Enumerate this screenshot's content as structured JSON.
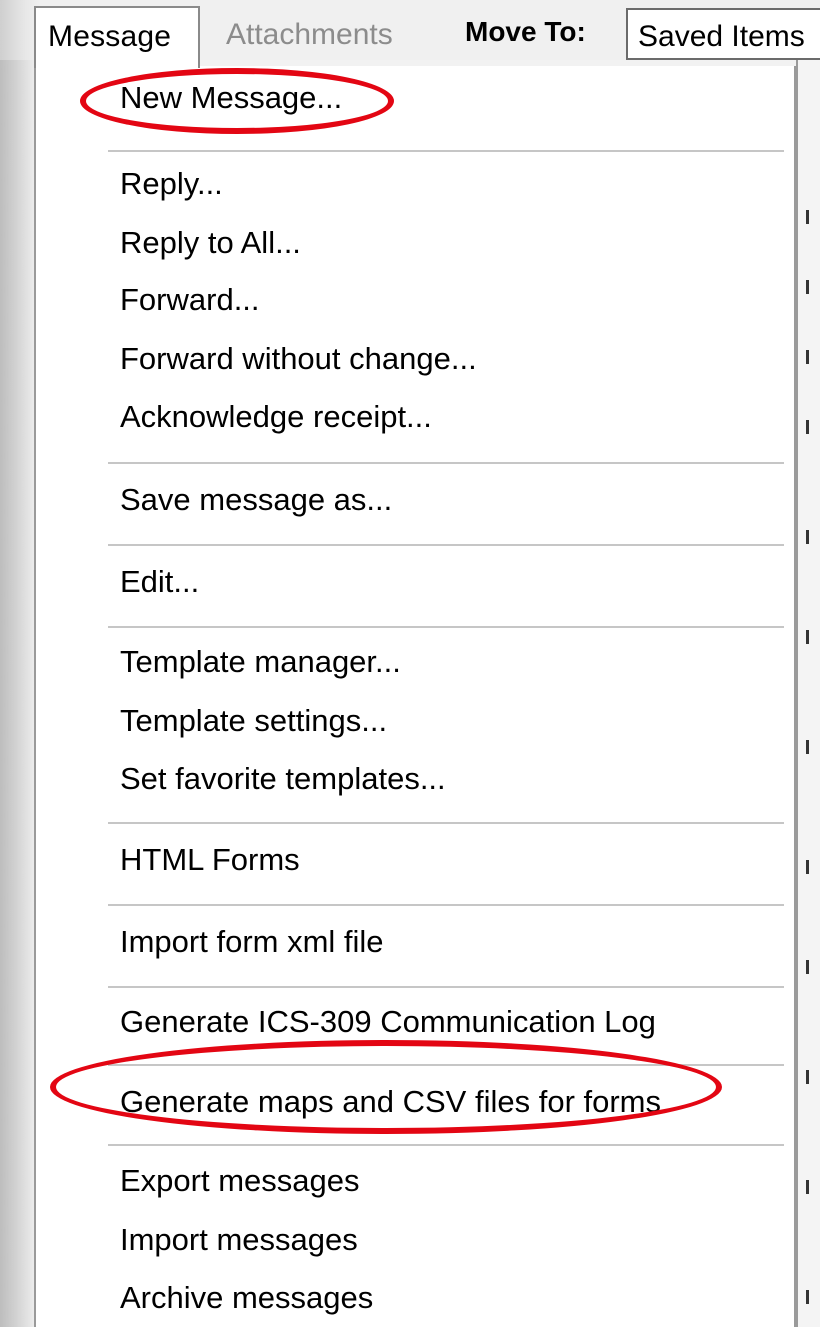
{
  "toolbar": {
    "menu_tab": "Message",
    "attachments_tab": "Attachments",
    "move_to_label": "Move To:",
    "folder_value": "Saved Items"
  },
  "menu": {
    "items": [
      "New Message...",
      "Reply...",
      "Reply to All...",
      "Forward...",
      "Forward without change...",
      "Acknowledge receipt...",
      "Save message as...",
      "Edit...",
      "Template manager...",
      "Template settings...",
      "Set favorite templates...",
      "HTML Forms",
      "Import form xml file",
      "Generate ICS-309 Communication Log",
      "Generate maps and CSV files for forms",
      "Export messages",
      "Import messages",
      "Archive messages"
    ]
  },
  "highlights": {
    "color": "#e30613",
    "items": [
      "New Message...",
      "Generate maps and CSV files for forms"
    ]
  }
}
